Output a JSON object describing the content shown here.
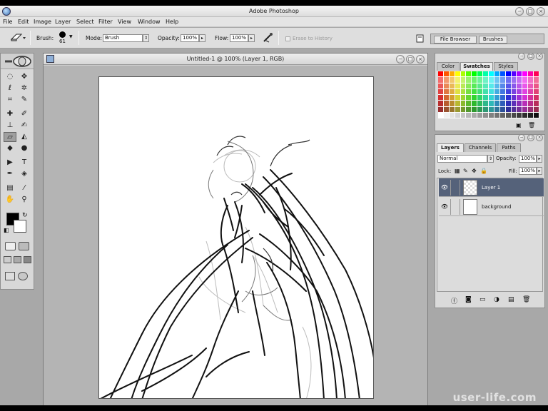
{
  "app": {
    "title": "Adobe Photoshop"
  },
  "window_controls": {
    "minimize": "−",
    "maximize": "□",
    "close": "×"
  },
  "menu": [
    "File",
    "Edit",
    "Image",
    "Layer",
    "Select",
    "Filter",
    "View",
    "Window",
    "Help"
  ],
  "options": {
    "brush_label": "Brush:",
    "brush_size": "61",
    "mode_label": "Mode:",
    "mode_value": "Brush",
    "opacity_label": "Opacity:",
    "opacity_value": "100%",
    "flow_label": "Flow:",
    "flow_value": "100%",
    "erase_to_history": "Erase to History",
    "tabs": [
      "File Browser",
      "Brushes"
    ]
  },
  "document": {
    "title": "Untitled-1 @ 100% (Layer 1, RGB)"
  },
  "tools": {
    "foreground_color": "#000000",
    "background_color": "#ffffff"
  },
  "color_palette": {
    "tabs": [
      "Color",
      "Swatches",
      "Styles"
    ],
    "active_tab": "Swatches"
  },
  "layers_palette": {
    "tabs": [
      "Layers",
      "Channels",
      "Paths"
    ],
    "blend_mode": "Normal",
    "opacity_label": "Opacity:",
    "opacity_value": "100%",
    "lock_label": "Lock:",
    "fill_label": "Fill:",
    "fill_value": "100%",
    "layers": [
      {
        "name": "Layer 1",
        "selected": true
      },
      {
        "name": "background",
        "selected": false
      }
    ]
  },
  "watermark": "user-life.com",
  "colors": {
    "selection": "#55627a",
    "workspace": "#a8a8a8"
  }
}
